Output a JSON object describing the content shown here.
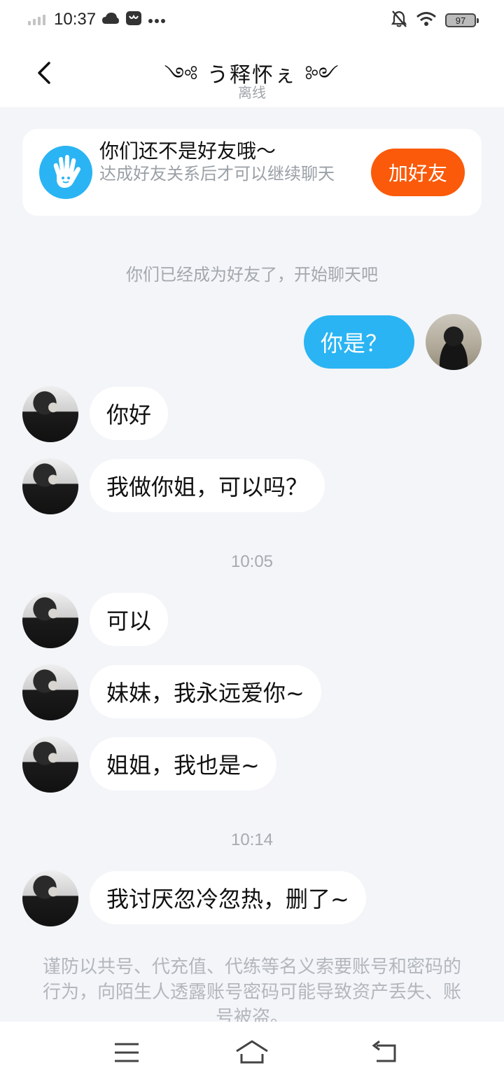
{
  "status_bar": {
    "time": "10:37",
    "battery": "97",
    "icons": [
      "signal-icon",
      "cloud-icon",
      "app-notification-icon",
      "more-dots-icon",
      "mute-bell-icon",
      "wifi-icon",
      "battery-icon"
    ]
  },
  "header": {
    "title": "༺ う释怀ぇ ༻",
    "status": "离线"
  },
  "friend_notice": {
    "title": "你们还不是好友哦～",
    "description": "达成好友关系后才可以继续聊天",
    "button": "加好友",
    "accent": "#fa5a0a"
  },
  "system_message": "你们已经成为好友了，开始聊天吧",
  "messages": {
    "m1": "你是？",
    "m2": "你好",
    "m3": "我做你姐，可以吗？",
    "t1": "10:05",
    "m4": "可以",
    "m5": "妹妹，我永远爱你~",
    "m6": "姐姐，我也是~",
    "t2": "10:14",
    "m7": "我讨厌忽冷忽热，删了~"
  },
  "warning": "谨防以共号、代充值、代练等名义索要账号和密码的行为，向陌生人透露账号密码可能导致资产丢失、账号被盗。",
  "colors": {
    "outgoing_bubble": "#2ab4f3",
    "incoming_bubble": "#ffffff",
    "background": "#f3f5f8"
  }
}
